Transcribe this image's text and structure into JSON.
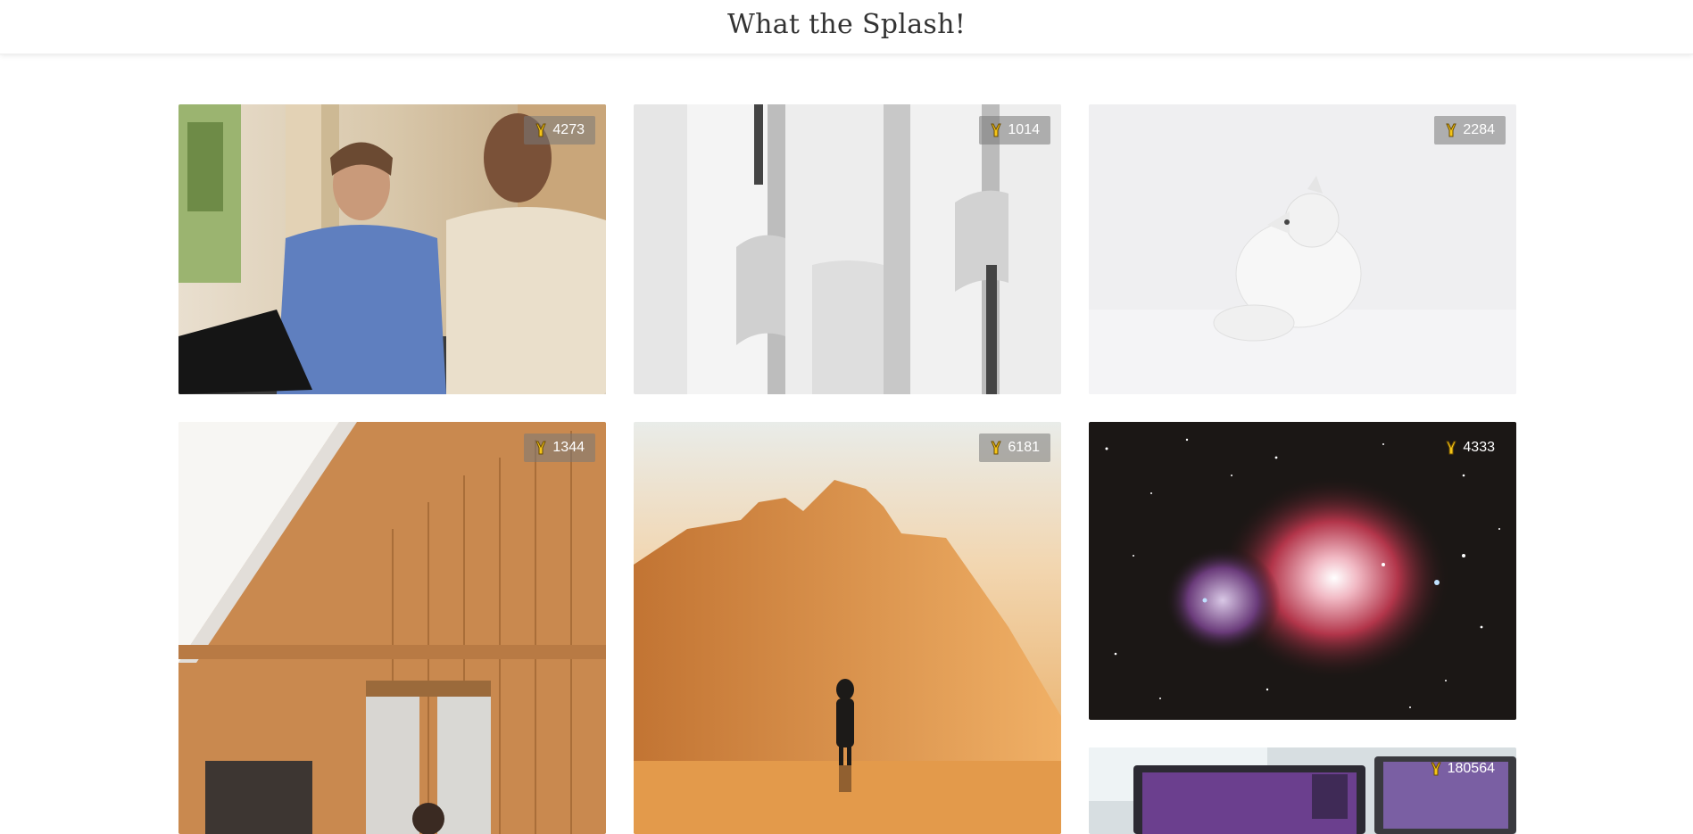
{
  "header": {
    "title": "What the Splash!"
  },
  "colors": {
    "badge_background": "rgba(120,120,120,0.55)",
    "like_icon": "#f5c518",
    "title_text": "#333333"
  },
  "photos": [
    {
      "subject": "two men working on a laptop",
      "likes": "4273",
      "icon": "like-icon"
    },
    {
      "subject": "white modernist building facade",
      "likes": "1014",
      "icon": "like-icon"
    },
    {
      "subject": "arctic fox in snow",
      "likes": "2284",
      "icon": "like-icon"
    },
    {
      "subject": "wood paneled interior room",
      "likes": "1344",
      "icon": "like-icon"
    },
    {
      "subject": "person standing before a misty mountain at sunrise",
      "likes": "6181",
      "icon": "like-icon"
    },
    {
      "subject": "orion nebula star field",
      "likes": "4333",
      "icon": "like-icon"
    },
    {
      "subject": "desk with monitors and laptop",
      "likes": "180564",
      "icon": "like-icon"
    }
  ]
}
